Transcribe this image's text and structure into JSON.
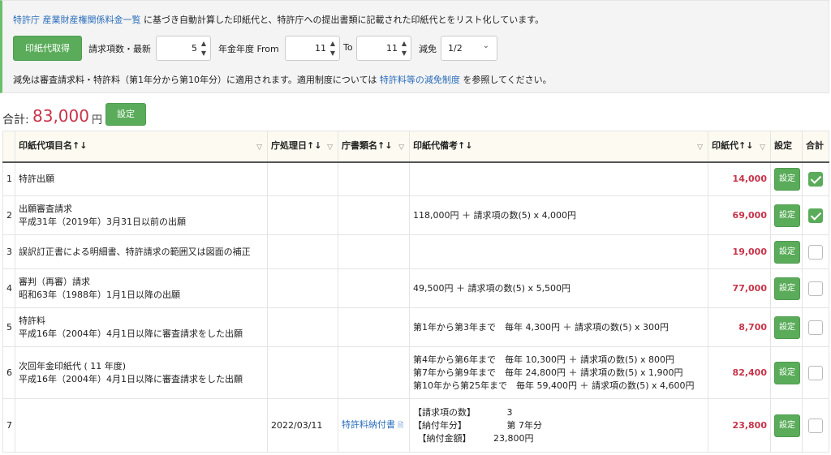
{
  "intro": {
    "link": "特許庁 産業財産権関係料金一覧",
    "text": "に基づき自動計算した印紙代と、特許庁への提出書類に記載された印紙代とをリスト化しています。"
  },
  "form": {
    "fetch_button": "印紙代取得",
    "claims_label": "請求項数・最新",
    "claims_value": "5",
    "year_label": "年金年度 From",
    "year_from": "11",
    "to_label": "To",
    "year_to": "11",
    "reduction_label": "減免",
    "reduction_value": "1/2"
  },
  "note": {
    "prefix": "減免は審査請求料・特許料（第1年分から第10年分）に適用されます。適用制度については",
    "link": "特許料等の減免制度",
    "suffix": "を参照してください。"
  },
  "total": {
    "label": "合計:",
    "amount": "83,000",
    "unit": "円",
    "button": "設定"
  },
  "columns": {
    "item": "印紙代項目名↑↓",
    "date": "庁処理日↑↓",
    "doc": "庁書類名↑↓",
    "remarks": "印紙代備考↑↓",
    "stamp": "印紙代↑↓",
    "setting": "設定",
    "sum": "合計"
  },
  "rows": [
    {
      "no": "1",
      "item": [
        "特許出願"
      ],
      "date": "",
      "doc": "",
      "remarks": [],
      "stamp": "14,000",
      "set": "設定",
      "checked": true
    },
    {
      "no": "2",
      "item": [
        "出願審査請求",
        "平成31年（2019年）3月31日以前の出願"
      ],
      "date": "",
      "doc": "",
      "remarks": [
        "118,000円 ＋ 請求項の数(5) x 4,000円"
      ],
      "stamp": "69,000",
      "set": "設定",
      "checked": true
    },
    {
      "no": "3",
      "item": [
        "誤訳訂正書による明細書、特許請求の範囲又は図面の補正"
      ],
      "date": "",
      "doc": "",
      "remarks": [],
      "stamp": "19,000",
      "set": "設定",
      "checked": false
    },
    {
      "no": "4",
      "item": [
        "審判（再審）請求",
        "昭和63年（1988年）1月1日以降の出願"
      ],
      "date": "",
      "doc": "",
      "remarks": [
        "49,500円 ＋ 請求項の数(5) x 5,500円"
      ],
      "stamp": "77,000",
      "set": "設定",
      "checked": false
    },
    {
      "no": "5",
      "item": [
        "特許料",
        "平成16年（2004年）4月1日以降に審査請求をした出願"
      ],
      "date": "",
      "doc": "",
      "remarks": [
        "第1年から第3年まで　毎年 4,300円 ＋ 請求項の数(5) x 300円"
      ],
      "stamp": "8,700",
      "set": "設定",
      "checked": false
    },
    {
      "no": "6",
      "item": [
        "次回年金印紙代 ( 11 年度)",
        "平成16年（2004年）4月1日以降に審査請求をした出願"
      ],
      "date": "",
      "doc": "",
      "remarks": [
        "第4年から第6年まで　毎年 10,300円 ＋ 請求項の数(5) x 800円",
        "第7年から第9年まで　毎年 24,800円 ＋ 請求項の数(5) x 1,900円",
        "第10年から第25年まで　毎年 59,400円 ＋ 請求項の数(5) x 4,600円"
      ],
      "stamp": "82,400",
      "set": "設定",
      "checked": false
    },
    {
      "no": "7",
      "item": [],
      "date": "2022/03/11",
      "doc": "特許料納付書",
      "remarks": [
        "【請求項の数】　　　　3",
        "【納付年分】　　　　　第 7年分",
        "　【納付金額】　　　23,800円"
      ],
      "stamp": "23,800",
      "set": "設定",
      "checked": false
    }
  ]
}
